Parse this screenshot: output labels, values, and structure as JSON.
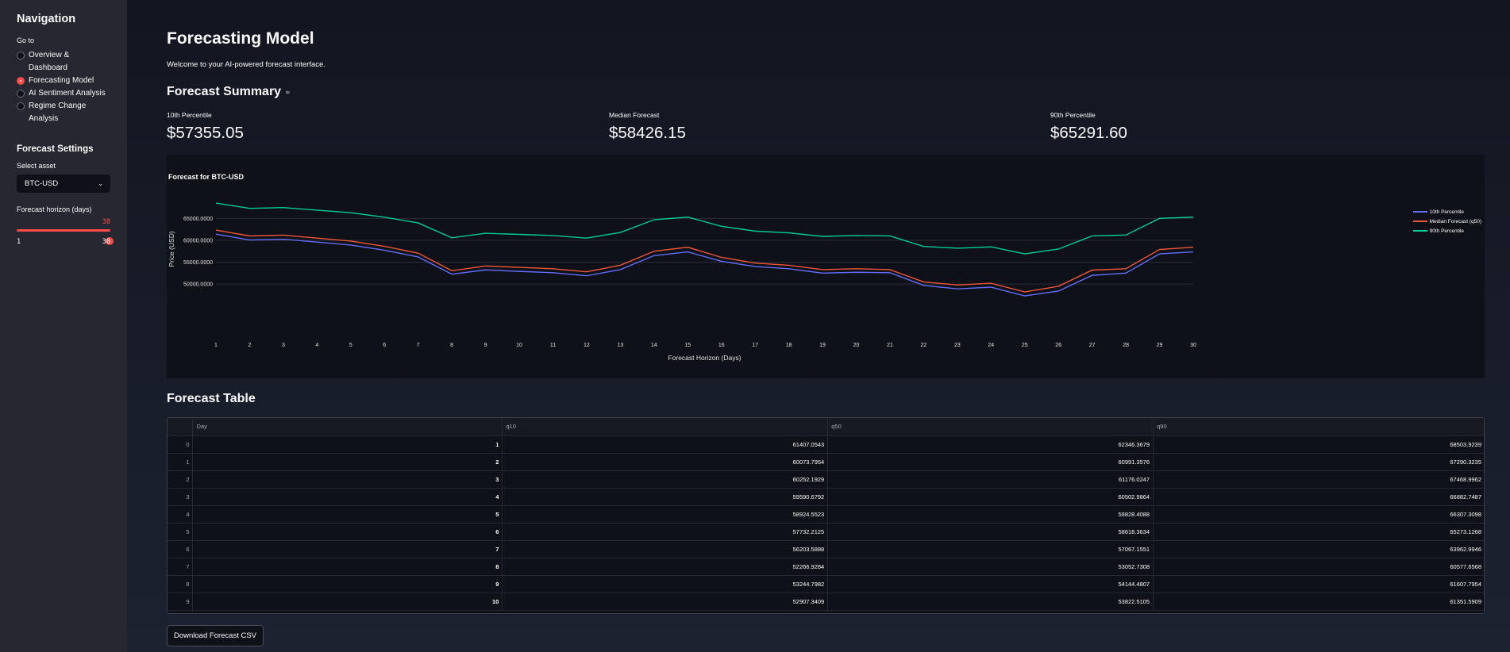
{
  "sidebar": {
    "title": "Navigation",
    "goto_label": "Go to",
    "nav": [
      {
        "label": "Overview & Dashboard",
        "line1": "Overview &",
        "line2": "Dashboard",
        "checked": false
      },
      {
        "label": "Forecasting Model",
        "line1": "Forecasting Model",
        "line2": "",
        "checked": true
      },
      {
        "label": "AI Sentiment Analysis",
        "line1": "AI Sentiment Analysis",
        "line2": "",
        "checked": false
      },
      {
        "label": "Regime Change Analysis",
        "line1": "Regime Change",
        "line2": "Analysis",
        "checked": false
      }
    ],
    "settings_title": "Forecast Settings",
    "asset_label": "Select asset",
    "asset_value": "BTC-USD",
    "horizon_label": "Forecast horizon (days)",
    "horizon_value": "30",
    "horizon_min": "1",
    "horizon_max": "30"
  },
  "main": {
    "title": "Forecasting Model",
    "welcome": "Welcome to your AI-powered forecast interface.",
    "summary_title": "Forecast Summary",
    "metrics": [
      {
        "label": "10th Percentile",
        "value": "$57355.05"
      },
      {
        "label": "Median Forecast",
        "value": "$58426.15"
      },
      {
        "label": "90th Percentile",
        "value": "$65291.60"
      }
    ],
    "table_title": "Forecast Table",
    "table_headers": [
      "",
      "Day",
      "q10",
      "q50",
      "q90"
    ],
    "table_rows": [
      [
        "0",
        "1",
        "61407.0543",
        "62346.3679",
        "68503.9239"
      ],
      [
        "1",
        "2",
        "60073.7954",
        "60991.3576",
        "67290.3235"
      ],
      [
        "2",
        "3",
        "60252.1929",
        "61176.0247",
        "67468.9962"
      ],
      [
        "3",
        "4",
        "59590.6792",
        "60502.9864",
        "66882.7487"
      ],
      [
        "4",
        "5",
        "58924.5523",
        "59828.4088",
        "66307.3098"
      ],
      [
        "5",
        "6",
        "57732.2125",
        "58618.3634",
        "65273.1268"
      ],
      [
        "6",
        "7",
        "56203.5888",
        "57067.1551",
        "63962.9946"
      ],
      [
        "7",
        "8",
        "52266.9284",
        "53052.7308",
        "60577.6568"
      ],
      [
        "8",
        "9",
        "53244.7982",
        "54144.4807",
        "61607.7954"
      ],
      [
        "9",
        "10",
        "52907.3409",
        "53822.5105",
        "61351.5909"
      ]
    ],
    "download_label": "Download Forecast CSV"
  },
  "colors": {
    "accent": "#ff4b4b",
    "q10": "#636efa",
    "q50": "#ef553b",
    "q90": "#00cc96"
  },
  "chart_data": {
    "type": "line",
    "title": "Forecast for BTC-USD",
    "xlabel": "Forecast Horizon (Days)",
    "ylabel": "Price (USD)",
    "x": [
      1,
      2,
      3,
      4,
      5,
      6,
      7,
      8,
      9,
      10,
      11,
      12,
      13,
      14,
      15,
      16,
      17,
      18,
      19,
      20,
      21,
      22,
      23,
      24,
      25,
      26,
      27,
      28,
      29,
      30
    ],
    "ylim": [
      45500,
      70500
    ],
    "yticks": [
      50000,
      55000,
      60000,
      65000
    ],
    "ytick_labels": [
      "50000.0000",
      "55000.0000",
      "60000.0000",
      "65000.0000"
    ],
    "grid": true,
    "legend": "right",
    "series": [
      {
        "name": "10th Percentile",
        "color": "#636efa",
        "values": [
          61407,
          60074,
          60252,
          59591,
          58925,
          57732,
          56204,
          52267,
          53245,
          52907,
          52600,
          51900,
          53300,
          56500,
          57355,
          55200,
          54000,
          53500,
          52500,
          52700,
          52600,
          49700,
          48900,
          49300,
          47300,
          48400,
          52000,
          52500,
          56900,
          57355
        ]
      },
      {
        "name": "Median Forecast (q50)",
        "color": "#ef553b",
        "values": [
          62346,
          60991,
          61176,
          60503,
          59828,
          58618,
          57067,
          53053,
          54144,
          53823,
          53500,
          52800,
          54300,
          57500,
          58426,
          56100,
          54800,
          54300,
          53300,
          53500,
          53300,
          50500,
          49800,
          50200,
          48200,
          49500,
          53200,
          53500,
          57900,
          58426
        ]
      },
      {
        "name": "90th Percentile",
        "color": "#00cc96",
        "values": [
          68504,
          67290,
          67469,
          66883,
          66307,
          65273,
          63963,
          60578,
          61608,
          61352,
          61100,
          60500,
          61800,
          64700,
          65292,
          63200,
          62100,
          61700,
          60900,
          61100,
          61000,
          58600,
          58200,
          58500,
          56900,
          58000,
          61000,
          61200,
          65000,
          65292
        ]
      }
    ]
  }
}
